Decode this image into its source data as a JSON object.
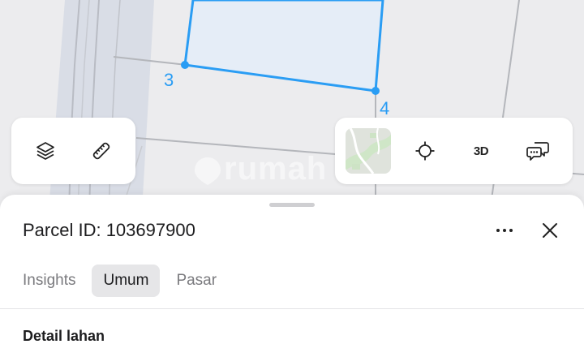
{
  "map": {
    "vertex_labels": [
      "3",
      "4"
    ],
    "watermark": "rumah",
    "accent_color": "#2a9df4"
  },
  "controls": {
    "left": [
      {
        "name": "layers-button",
        "icon": "layers-icon"
      },
      {
        "name": "measure-button",
        "icon": "ruler-icon"
      }
    ],
    "right": [
      {
        "name": "basemap-thumbnail",
        "icon": "map-thumbnail-icon"
      },
      {
        "name": "locate-button",
        "icon": "crosshair-icon"
      },
      {
        "name": "3d-button",
        "label": "3D"
      },
      {
        "name": "feedback-button",
        "icon": "chat-bubbles-icon"
      }
    ]
  },
  "sheet": {
    "title": "Parcel ID: 103697900",
    "tabs": [
      {
        "label": "Insights",
        "active": false
      },
      {
        "label": "Umum",
        "active": true
      },
      {
        "label": "Pasar",
        "active": false
      }
    ],
    "section_title": "Detail lahan"
  }
}
